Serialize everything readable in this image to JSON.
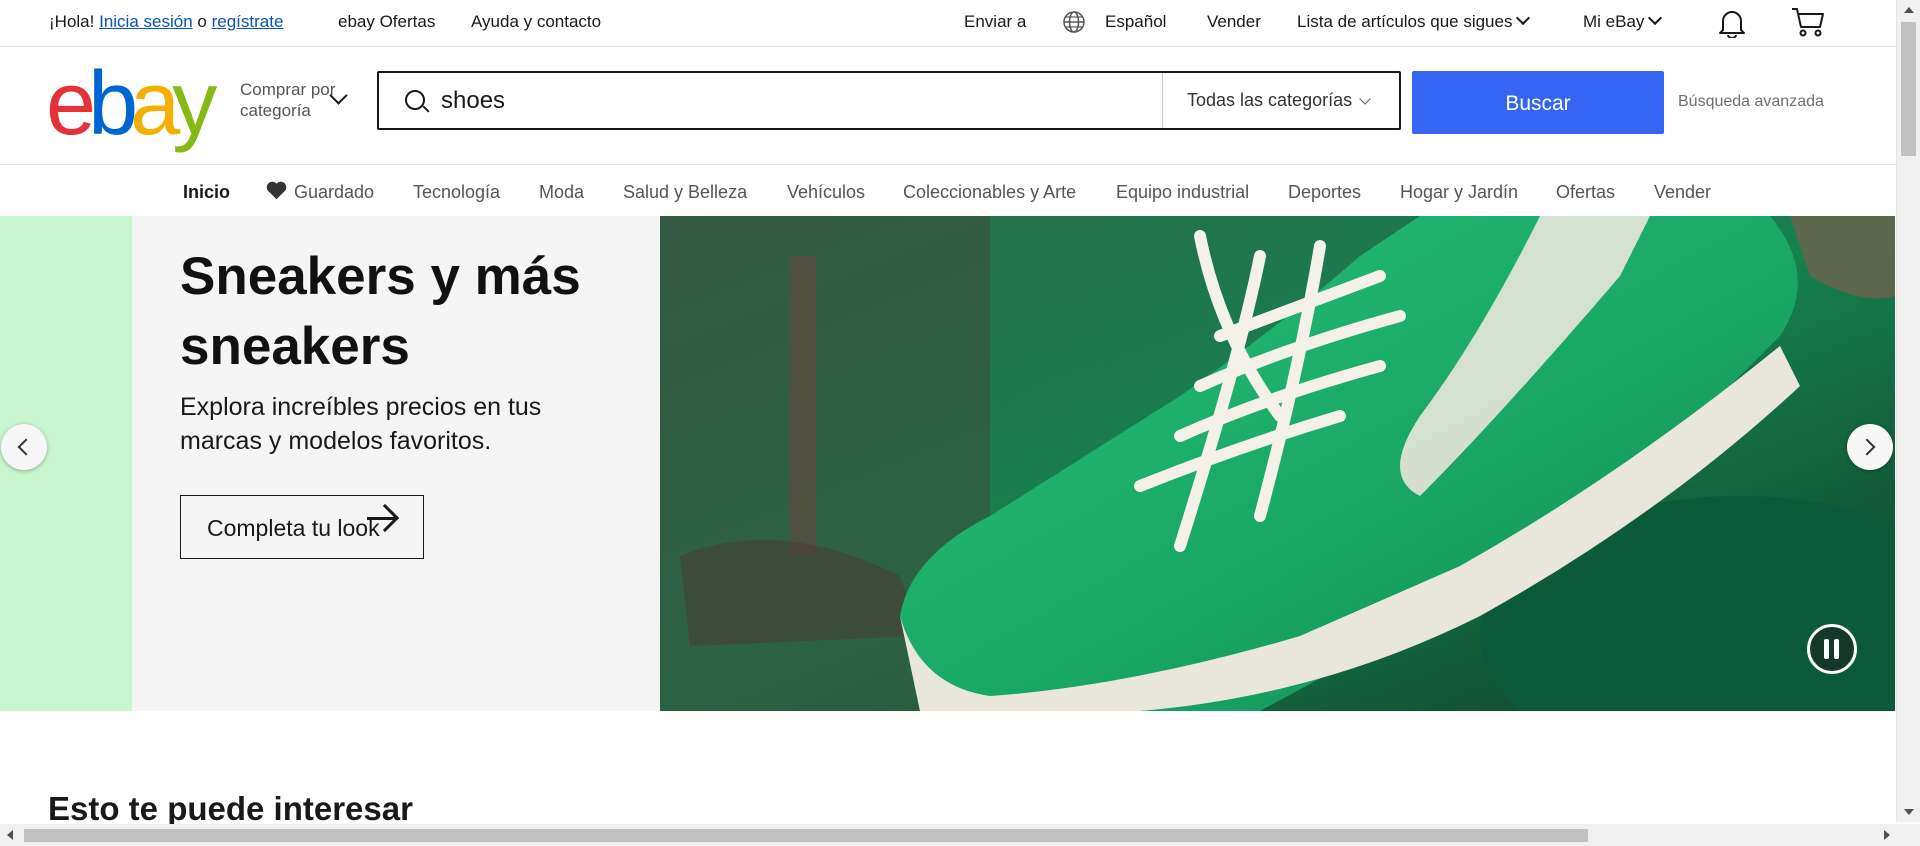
{
  "topbar": {
    "greeting": "¡Hola!",
    "signin": "Inicia sesión",
    "or": "o",
    "register": "regístrate",
    "deals": "ebay Ofertas",
    "help": "Ayuda y contacto",
    "ship_to": "Enviar a",
    "language": "Español",
    "sell": "Vender",
    "watchlist": "Lista de artículos que sigues",
    "my_ebay": "Mi eBay"
  },
  "header": {
    "logo_letters": [
      "e",
      "b",
      "a",
      "y"
    ],
    "shop_by_category": "Comprar por categoría",
    "search_value": "shoes",
    "category_select": "Todas las categorías",
    "search_button": "Buscar",
    "advanced": "Búsqueda avanzada"
  },
  "nav": {
    "items": [
      "Inicio",
      "Guardado",
      "Tecnología",
      "Moda",
      "Salud y Belleza",
      "Vehículos",
      "Coleccionables y Arte",
      "Equipo industrial",
      "Deportes",
      "Hogar y Jardín",
      "Ofertas",
      "Vender"
    ],
    "active": "Inicio"
  },
  "hero": {
    "title": "Sneakers y más sneakers",
    "subtitle": "Explora increíbles precios en tus marcas y modelos favoritos.",
    "cta": "Completa tu look",
    "accent_color": "#c8f7cf",
    "shoe_color": "#1fa65f"
  },
  "main": {
    "section_title": "Esto te puede interesar"
  },
  "colors": {
    "brand_blue": "#3665f3",
    "link": "#0654ba"
  }
}
